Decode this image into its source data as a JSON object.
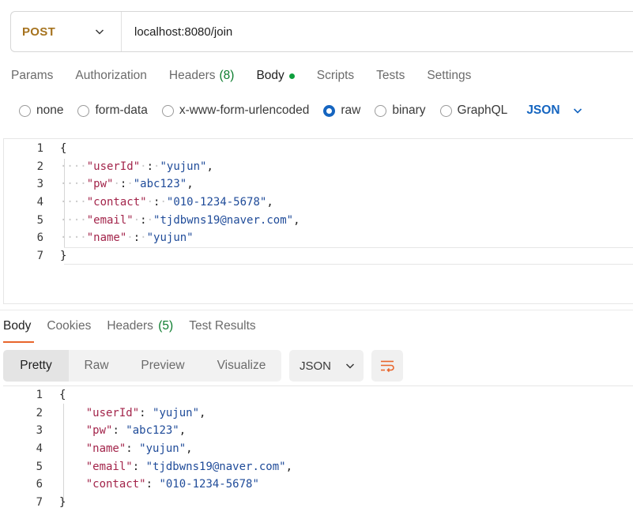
{
  "request": {
    "method": "POST",
    "url": "localhost:8080/join"
  },
  "request_tabs": {
    "params": "Params",
    "authorization": "Authorization",
    "headers": "Headers",
    "headers_count": "(8)",
    "body": "Body",
    "scripts": "Scripts",
    "tests": "Tests",
    "settings": "Settings"
  },
  "body_types": {
    "none": "none",
    "form_data": "form-data",
    "urlencoded": "x-www-form-urlencoded",
    "raw": "raw",
    "binary": "binary",
    "graphql": "GraphQL",
    "selected": "raw",
    "language": "JSON"
  },
  "request_body": {
    "line_numbers": [
      "1",
      "2",
      "3",
      "4",
      "5",
      "6",
      "7"
    ],
    "open_brace": "{",
    "close_brace": "}",
    "fields": [
      {
        "key": "\"userId\"",
        "value": "\"yujun\"",
        "trail": ","
      },
      {
        "key": "\"pw\"",
        "value": "\"abc123\"",
        "trail": ","
      },
      {
        "key": "\"contact\"",
        "value": "\"010-1234-5678\"",
        "trail": ","
      },
      {
        "key": "\"email\"",
        "value": "\"tjdbwns19@naver.com\"",
        "trail": ","
      },
      {
        "key": "\"name\"",
        "value": "\"yujun\"",
        "trail": ""
      }
    ]
  },
  "response_tabs": {
    "body": "Body",
    "cookies": "Cookies",
    "headers": "Headers",
    "headers_count": "(5)",
    "test_results": "Test Results"
  },
  "response_toolbar": {
    "pretty": "Pretty",
    "raw": "Raw",
    "preview": "Preview",
    "visualize": "Visualize",
    "format": "JSON"
  },
  "response_body": {
    "line_numbers": [
      "1",
      "2",
      "3",
      "4",
      "5",
      "6",
      "7"
    ],
    "open_brace": "{",
    "close_brace": "}",
    "fields": [
      {
        "key": "\"userId\"",
        "value": "\"yujun\"",
        "trail": ","
      },
      {
        "key": "\"pw\"",
        "value": "\"abc123\"",
        "trail": ","
      },
      {
        "key": "\"name\"",
        "value": "\"yujun\"",
        "trail": ","
      },
      {
        "key": "\"email\"",
        "value": "\"tjdbwns19@naver.com\"",
        "trail": ","
      },
      {
        "key": "\"contact\"",
        "value": "\"010-1234-5678\"",
        "trail": ""
      }
    ]
  },
  "colors": {
    "method": "#a6731f",
    "accent_blue": "#1565c0",
    "count_green": "#0c7d2e",
    "json_key": "#a3254b",
    "json_string": "#1f4b99",
    "active_tab_underline": "#e8662c"
  },
  "icons": {
    "method_dropdown": "chevron-down-icon",
    "language_dropdown": "chevron-down-icon",
    "format_dropdown": "chevron-down-icon",
    "wrap": "wrap-lines-icon",
    "body_status": "green-dot-icon"
  }
}
